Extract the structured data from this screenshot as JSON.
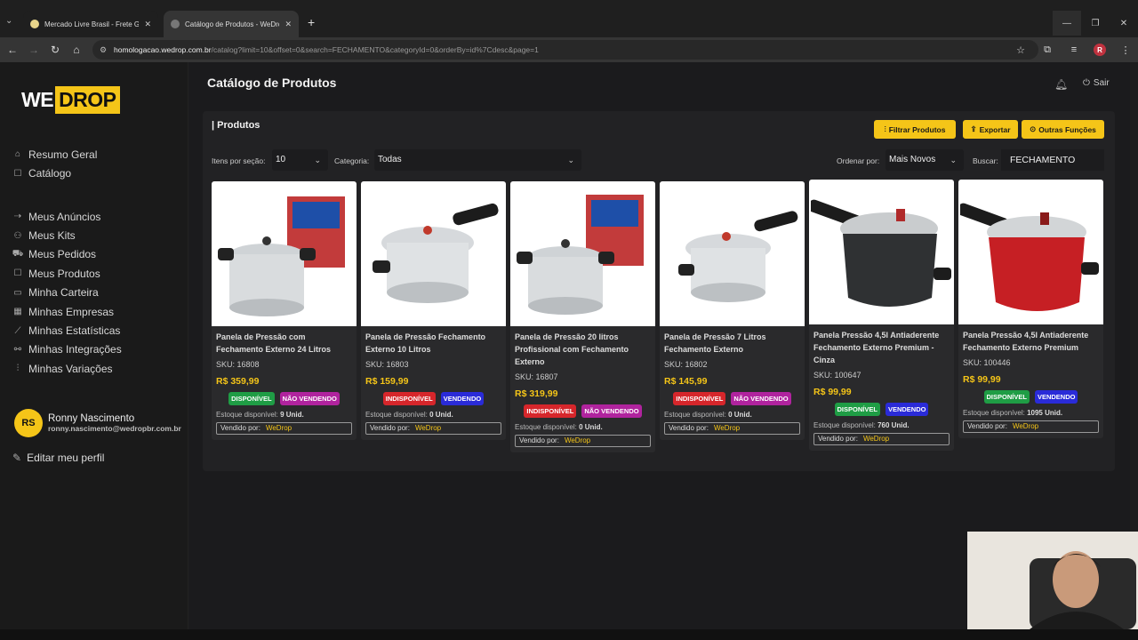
{
  "browser": {
    "tabs": [
      {
        "title": "Mercado Livre Brasil - Frete Grá",
        "active": false
      },
      {
        "title": "Catálogo de Produtos - WeDrop",
        "active": true
      }
    ],
    "url_host": "homologacao.wedrop.com.br",
    "url_path": "/catalog?limit=10&offset=0&search=FECHAMENTO&categoryId=0&orderBy=id%7Cdesc&page=1"
  },
  "logo": {
    "part1": "WE",
    "part2": "DROP"
  },
  "sidebar": {
    "group1": [
      {
        "label": "Resumo Geral",
        "icon": "home-icon"
      },
      {
        "label": "Catálogo",
        "icon": "catalog-icon"
      }
    ],
    "group2": [
      {
        "label": "Meus Anúncios",
        "icon": "ads-icon"
      },
      {
        "label": "Meus Kits",
        "icon": "kits-icon"
      },
      {
        "label": "Meus Pedidos",
        "icon": "orders-icon"
      },
      {
        "label": "Meus Produtos",
        "icon": "products-icon"
      },
      {
        "label": "Minha Carteira",
        "icon": "wallet-icon"
      },
      {
        "label": "Minhas Empresas",
        "icon": "companies-icon"
      },
      {
        "label": "Minhas Estatísticas",
        "icon": "stats-icon"
      },
      {
        "label": "Minhas Integrações",
        "icon": "integrations-icon"
      },
      {
        "label": "Minhas Variações",
        "icon": "variations-icon"
      }
    ],
    "user": {
      "initials": "RS",
      "name": "Ronny Nascimento",
      "email": "ronny.nascimento@wedropbr.com.br"
    },
    "edit_profile": "Editar meu perfil"
  },
  "header": {
    "title": "Catálogo de Produtos",
    "logout": "Sair"
  },
  "panel": {
    "title": "| Produtos",
    "buttons": {
      "filter": "Filtrar Produtos",
      "export": "Exportar",
      "more": "Outras Funções"
    },
    "items_label": "Itens por seção:",
    "items_value": "10",
    "category_label": "Categoria:",
    "category_value": "Todas",
    "order_label": "Ordenar por:",
    "order_value": "Mais Novos",
    "search_label": "Buscar:",
    "search_value": "FECHAMENTO"
  },
  "products": [
    {
      "name": "Panela de Pressão com Fechamento Externo 24 Litros",
      "sku": "SKU: 16808",
      "price": "R$ 359,99",
      "badge1": "DISPONÍVEL",
      "badge2": "NÃO VENDENDO",
      "stock_label": "Estoque disponível:",
      "stock": "9 Unid.",
      "seller_label": "Vendido por:",
      "seller": "WeDrop"
    },
    {
      "name": "Panela de Pressão Fechamento Externo 10 Litros",
      "sku": "SKU: 16803",
      "price": "R$ 159,99",
      "badge1": "INDISPONÍVEL",
      "badge2": "VENDENDO",
      "stock_label": "Estoque disponível:",
      "stock": "0 Unid.",
      "seller_label": "Vendido por:",
      "seller": "WeDrop"
    },
    {
      "name": "Panela de Pressão 20 litros Profissional com Fechamento Externo",
      "sku": "SKU: 16807",
      "price": "R$ 319,99",
      "badge1": "INDISPONÍVEL",
      "badge2": "NÃO VENDENDO",
      "stock_label": "Estoque disponível:",
      "stock": "0 Unid.",
      "seller_label": "Vendido por:",
      "seller": "WeDrop"
    },
    {
      "name": "Panela de Pressão 7 Litros Fechamento Externo",
      "sku": "SKU: 16802",
      "price": "R$ 145,99",
      "badge1": "INDISPONÍVEL",
      "badge2": "NÃO VENDENDO",
      "stock_label": "Estoque disponível:",
      "stock": "0 Unid.",
      "seller_label": "Vendido por:",
      "seller": "WeDrop"
    },
    {
      "name": "Panela Pressão 4,5l Antiaderente Fechamento Externo Premium - Cinza",
      "sku": "SKU: 100647",
      "price": "R$ 99,99",
      "badge1": "DISPONÍVEL",
      "badge2": "VENDENDO",
      "stock_label": "Estoque disponível:",
      "stock": "760 Unid.",
      "seller_label": "Vendido por:",
      "seller": "WeDrop"
    },
    {
      "name": "Panela Pressão 4,5l Antiaderente Fechamento Externo Premium",
      "sku": "SKU: 100446",
      "price": "R$ 99,99",
      "badge1": "DISPONÍVEL",
      "badge2": "VENDENDO",
      "stock_label": "Estoque disponível:",
      "stock": "1095 Unid.",
      "seller_label": "Vendido por:",
      "seller": "WeDrop"
    }
  ],
  "colors": {
    "accent": "#f5c518",
    "available": "#1f9d45",
    "unavailable": "#d6262b",
    "not_selling": "#b0239e",
    "selling": "#2a2bd8"
  }
}
